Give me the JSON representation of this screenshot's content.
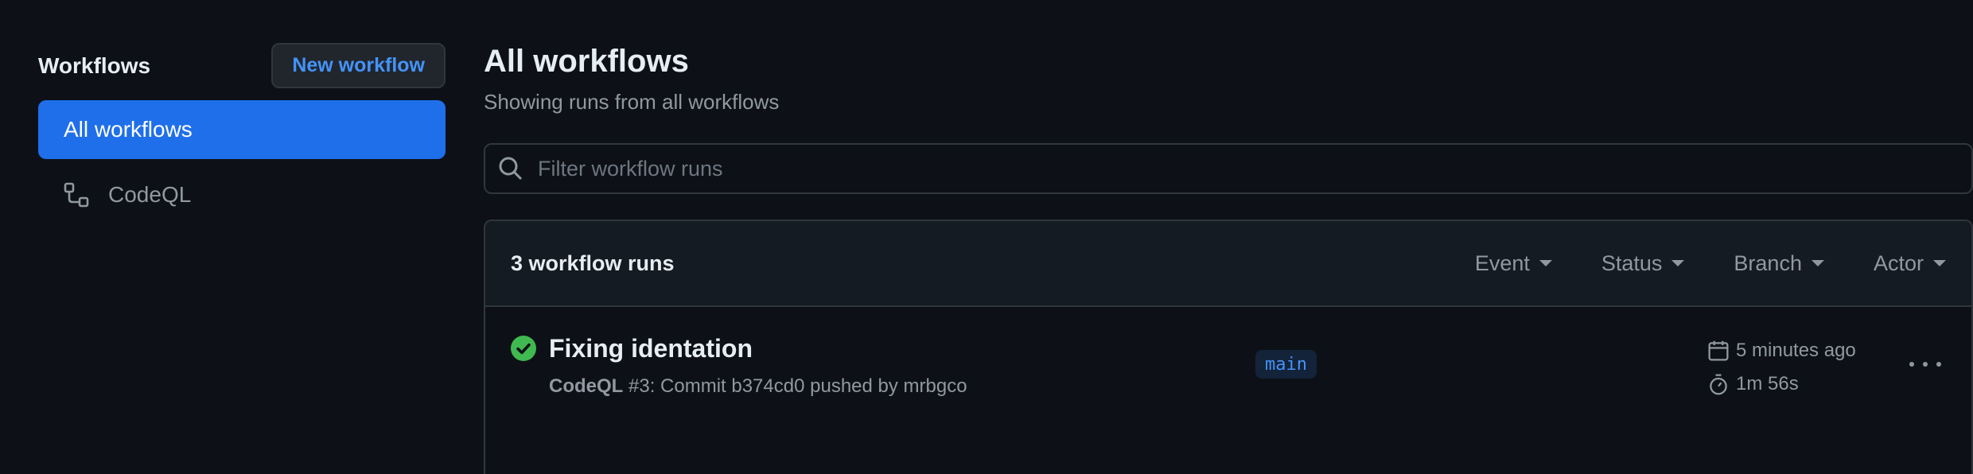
{
  "sidebar": {
    "title": "Workflows",
    "new_workflow_label": "New workflow",
    "items": [
      {
        "label": "All workflows",
        "active": true
      },
      {
        "label": "CodeQL",
        "icon": "workflow-icon"
      }
    ]
  },
  "main": {
    "title": "All workflows",
    "subtitle": "Showing runs from all workflows",
    "search": {
      "placeholder": "Filter workflow runs",
      "value": ""
    },
    "runs_header": {
      "count_label": "3 workflow runs",
      "filters": [
        "Event",
        "Status",
        "Branch",
        "Actor"
      ]
    },
    "runs": [
      {
        "title": "Fixing identation",
        "workflow": "CodeQL",
        "details": "#3: Commit b374cd0 pushed by mrbgco",
        "branch": "main",
        "time_ago": "5 minutes ago",
        "duration": "1m 56s",
        "status": "success"
      }
    ]
  },
  "colors": {
    "background": "#0d1117",
    "accent": "#1f6feb",
    "link": "#4493f8",
    "success": "#3fb950",
    "muted": "#9198a1"
  }
}
